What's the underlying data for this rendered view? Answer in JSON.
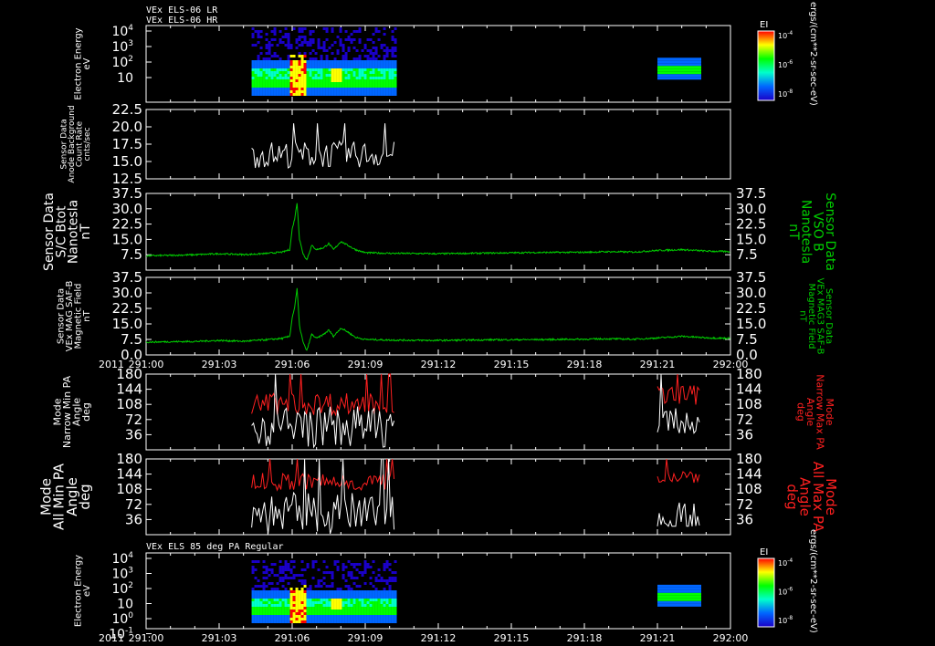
{
  "chart_data": [
    {
      "type": "heatmap",
      "titles": [
        "VEx ELS-06 LR",
        "VEx ELS-06 HR"
      ],
      "ylabel": [
        "Electron Energy",
        "eV"
      ],
      "y_scale": "log",
      "y_ticks": [
        "10",
        "10",
        "10",
        "10"
      ],
      "y_tick_exponents": [
        "",
        "2",
        "3",
        "4"
      ],
      "colorbar": {
        "title": "EI",
        "unit": "ergs/(cm**2-sr-sec-eV)",
        "ticks": [
          "10",
          "10",
          "10"
        ],
        "tick_exponents": [
          "-4",
          "-6",
          "-8"
        ]
      },
      "data_segments": [
        {
          "x_start": "291:04:20",
          "x_end": "291:10:15"
        },
        {
          "x_start": "291:21:00",
          "x_end": "291:22:45"
        }
      ],
      "colormap": [
        "#1a00c8",
        "#0066ff",
        "#00ffcc",
        "#00ff00",
        "#ffff00",
        "#ff0000"
      ]
    },
    {
      "type": "line",
      "ylabel": [
        "Sensor Data",
        "Anode Background",
        "Count Rate",
        "cnts/sec"
      ],
      "ylim": [
        12.5,
        22.5
      ],
      "y_ticks": [
        "12.5",
        "15.0",
        "17.5",
        "20.0",
        "22.5"
      ],
      "series": [
        {
          "color": "#ffffff",
          "x_start": "291:04:20",
          "x_end": "291:10:15",
          "y_min": 13.5,
          "y_max": 20.5,
          "y_mean": 16.0
        }
      ]
    },
    {
      "type": "line",
      "ylabel": [
        "Sensor Data",
        "S/C Btot",
        "Nanotesla",
        "nT"
      ],
      "ylabel_right": [
        "Sensor Data",
        "VSO B",
        "Nanotesla",
        "nT"
      ],
      "ylim": [
        0,
        37.5
      ],
      "y_ticks": [
        "7.5",
        "15.0",
        "22.5",
        "30.0",
        "37.5"
      ],
      "series": [
        {
          "color": "#00cc00",
          "y": [
            [
              0,
              7.0
            ],
            [
              1,
              7.2
            ],
            [
              2,
              7.5
            ],
            [
              3,
              8.0
            ],
            [
              4,
              7.6
            ],
            [
              4.5,
              7.8
            ],
            [
              5.0,
              8.2
            ],
            [
              5.6,
              8.8
            ],
            [
              5.9,
              10
            ],
            [
              6.0,
              20
            ],
            [
              6.1,
              25
            ],
            [
              6.2,
              33
            ],
            [
              6.3,
              15
            ],
            [
              6.45,
              8
            ],
            [
              6.6,
              5
            ],
            [
              6.8,
              12
            ],
            [
              7.0,
              10
            ],
            [
              7.3,
              11
            ],
            [
              7.5,
              13
            ],
            [
              7.7,
              10
            ],
            [
              8.0,
              14
            ],
            [
              8.3,
              12
            ],
            [
              8.6,
              10
            ],
            [
              9.0,
              8.5
            ],
            [
              10,
              8.2
            ],
            [
              12,
              8.0
            ],
            [
              14,
              8.3
            ],
            [
              16,
              8.6
            ],
            [
              18,
              8.7
            ],
            [
              19,
              9.0
            ],
            [
              20,
              8.8
            ],
            [
              21,
              9.6
            ],
            [
              22,
              10.0
            ],
            [
              23,
              9.3
            ],
            [
              24,
              9.0
            ]
          ]
        }
      ]
    },
    {
      "type": "line",
      "ylabel": [
        "Sensor Data",
        "VEx MAG SAF-B",
        "Magnetic Field",
        "nT"
      ],
      "ylabel_right": [
        "Sensor Data",
        "VEx MAG3 SAF-B",
        "Magnetic Field",
        "nT"
      ],
      "ylim": [
        0,
        37.5
      ],
      "y_ticks": [
        "0.0",
        "7.5",
        "15.0",
        "22.5",
        "30.0",
        "37.5"
      ],
      "series": [
        {
          "color": "#00cc00",
          "y": [
            [
              0,
              6.2
            ],
            [
              1,
              6.4
            ],
            [
              2,
              6.5
            ],
            [
              3,
              7.0
            ],
            [
              4,
              6.6
            ],
            [
              4.5,
              7.0
            ],
            [
              5.0,
              7.4
            ],
            [
              5.6,
              8.0
            ],
            [
              5.9,
              9
            ],
            [
              6.0,
              18
            ],
            [
              6.1,
              23
            ],
            [
              6.2,
              32
            ],
            [
              6.3,
              14
            ],
            [
              6.45,
              6
            ],
            [
              6.6,
              2
            ],
            [
              6.8,
              10
            ],
            [
              7.0,
              8
            ],
            [
              7.3,
              10
            ],
            [
              7.5,
              12
            ],
            [
              7.7,
              9
            ],
            [
              8.0,
              13
            ],
            [
              8.3,
              11
            ],
            [
              8.6,
              8.5
            ],
            [
              9.0,
              7.5
            ],
            [
              10,
              7.2
            ],
            [
              12,
              7.0
            ],
            [
              14,
              7.3
            ],
            [
              16,
              7.4
            ],
            [
              18,
              7.6
            ],
            [
              19,
              7.8
            ],
            [
              20,
              7.6
            ],
            [
              21,
              8.2
            ],
            [
              22,
              9.0
            ],
            [
              23,
              8.3
            ],
            [
              24,
              8.0
            ]
          ]
        }
      ]
    },
    {
      "type": "line",
      "ylabel": [
        "Mode",
        "Narrow Min PA",
        "Angle",
        "deg"
      ],
      "ylabel_right": [
        "Mode",
        "Narrow Max PA",
        "Angle",
        "deg"
      ],
      "ylim": [
        0,
        180
      ],
      "y_ticks": [
        "36",
        "72",
        "108",
        "144",
        "180"
      ],
      "series": [
        {
          "color": "#ff2020",
          "segments": [
            {
              "x_start": "291:04:20",
              "x_end": "291:10:15",
              "y_min": 80,
              "y_max": 180,
              "y_mean": 110
            },
            {
              "x_start": "291:21:00",
              "x_end": "291:22:45",
              "y_min": 95,
              "y_max": 180,
              "y_mean": 130
            }
          ]
        },
        {
          "color": "#ffffff",
          "segments": [
            {
              "x_start": "291:04:20",
              "x_end": "291:10:15",
              "y_min": 0,
              "y_max": 180,
              "y_mean": 55
            },
            {
              "x_start": "291:21:00",
              "x_end": "291:22:45",
              "y_min": 40,
              "y_max": 180,
              "y_mean": 60
            }
          ]
        }
      ]
    },
    {
      "type": "line",
      "ylabel": [
        "Mode",
        "All Min PA",
        "Angle",
        "deg"
      ],
      "ylabel_right": [
        "Mode",
        "All Max PA",
        "Angle",
        "deg"
      ],
      "ylim": [
        0,
        180
      ],
      "y_ticks": [
        "36",
        "72",
        "108",
        "144",
        "180"
      ],
      "series": [
        {
          "color": "#ff2020",
          "segments": [
            {
              "x_start": "291:04:20",
              "x_end": "291:10:15",
              "y_min": 100,
              "y_max": 180,
              "y_mean": 125
            },
            {
              "x_start": "291:21:00",
              "x_end": "291:22:45",
              "y_min": 120,
              "y_max": 180,
              "y_mean": 140
            }
          ]
        },
        {
          "color": "#ffffff",
          "segments": [
            {
              "x_start": "291:04:20",
              "x_end": "291:10:15",
              "y_min": 0,
              "y_max": 180,
              "y_mean": 50
            },
            {
              "x_start": "291:21:00",
              "x_end": "291:22:45",
              "y_min": 20,
              "y_max": 180,
              "y_mean": 35
            }
          ]
        }
      ]
    },
    {
      "type": "heatmap",
      "titles": [
        "VEx ELS 85 deg PA Regular"
      ],
      "ylabel": [
        "Electron Energy",
        "eV"
      ],
      "y_scale": "log",
      "y_ticks": [
        "10",
        "10",
        "10",
        "10",
        "10",
        "10"
      ],
      "y_tick_exponents": [
        "-1",
        "0",
        "",
        "2",
        "3",
        "4"
      ],
      "colorbar": {
        "title": "EI",
        "unit": "ergs/(cm**2-sr-sec-eV)",
        "ticks": [
          "10",
          "10",
          "10"
        ],
        "tick_exponents": [
          "-4",
          "-6",
          "-8"
        ]
      },
      "data_segments": [
        {
          "x_start": "291:04:20",
          "x_end": "291:10:15"
        },
        {
          "x_start": "291:21:00",
          "x_end": "291:22:45"
        }
      ],
      "colormap": [
        "#1a00c8",
        "#0066ff",
        "#00ffcc",
        "#00ff00",
        "#ffff00",
        "#ff0000"
      ]
    }
  ],
  "x_axis": {
    "year_label": "2011",
    "tick_labels": [
      "291:00",
      "291:03",
      "291:06",
      "291:09",
      "291:12",
      "291:15",
      "291:18",
      "291:21",
      "292:00"
    ],
    "range": [
      "291:00:00",
      "292:00:00"
    ]
  }
}
